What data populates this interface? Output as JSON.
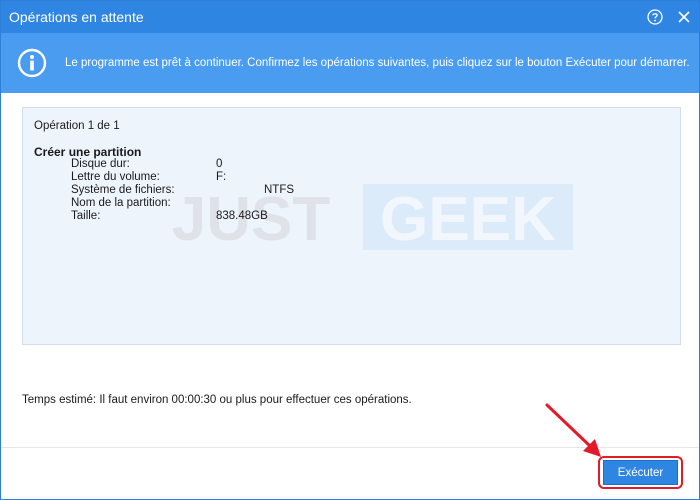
{
  "window": {
    "title": "Opérations en attente",
    "accent_color": "#2f85e2",
    "buttons": {
      "help_icon": "question-circle-icon",
      "close_icon": "close-icon"
    }
  },
  "info": {
    "icon": "info-circle-icon",
    "message": "Le programme est prêt à continuer. Confirmez les opérations suivantes, puis cliquez sur le bouton Exécuter pour démarrer."
  },
  "operations": {
    "counter": "Opération 1 de 1",
    "name": "Créer une partition",
    "details": [
      {
        "label": "Disque dur:",
        "value": "0"
      },
      {
        "label": "Lettre du volume:",
        "value": "F:"
      },
      {
        "label": "Système de fichiers:",
        "value": "NTFS"
      },
      {
        "label": "Nom de la partition:",
        "value": ""
      },
      {
        "label": "Taille:",
        "value": "838.48GB"
      }
    ]
  },
  "watermark": {
    "text_part1": "JUST",
    "text_part2": "GEEK"
  },
  "estimate": "Temps estimé: Il faut environ 00:00:30 ou plus pour effectuer ces opérations.",
  "footer": {
    "execute_label": "Exécuter",
    "highlight_color": "#e21b2b"
  }
}
